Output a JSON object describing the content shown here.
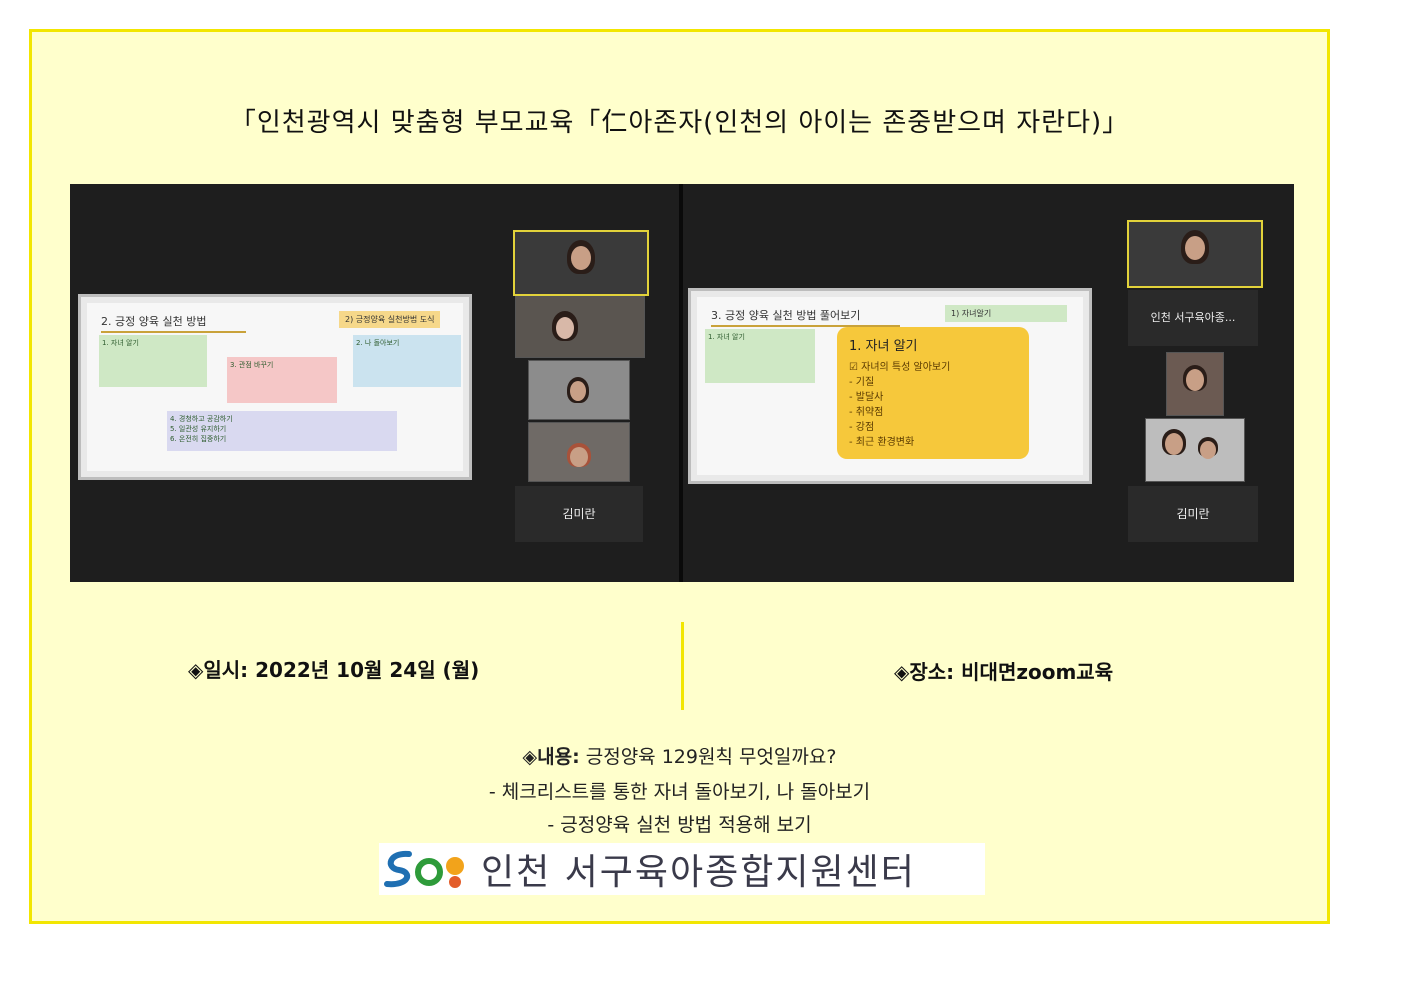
{
  "title": "「인천광역시 맞춤형 부모교육「仁아존자(인천의 아이는 존중받으며 자란다)」",
  "left_screen": {
    "slide_title": "2. 긍정 양육 실천 방법",
    "slide_tag": "2) 긍정양육 실천방법 도식",
    "boxes": [
      "1. 자녀 알기",
      "2. 나 돌아보기",
      "3. 관점 바꾸기",
      "4. 경청하고 공감하기\n5. 일관성 유지하기\n6. 온전히 집중하기"
    ],
    "participant_name": "김미란",
    "captions": [
      "",
      "",
      "",
      "",
      "김미란"
    ]
  },
  "right_screen": {
    "slide_title": "3. 긍정 양육 실천 방법 풀어보기",
    "slide_tag": "1) 자녀알기",
    "box": "1. 자녀 알기",
    "bubble": {
      "title": "1. 자녀 알기",
      "check": "자녀의 특성 알아보기",
      "items": [
        "- 기질",
        "- 발달사",
        "- 취약점",
        "- 강점",
        "- 최근 환경변화"
      ]
    },
    "center_label": "인천 서구육아종...",
    "center_caption": "인천 서구육아종합지원센터",
    "participant_name": "김미란",
    "captions": [
      "",
      "김미란"
    ]
  },
  "date_label": "◈일시: 2022년 10월 24일 (월)",
  "place_label": "◈장소: 비대면zoom교육",
  "content": {
    "label": "◈내용:",
    "text": " 긍정양육 129원칙 무엇일까요?",
    "line2": "-  체크리스트를 통한 자녀 돌아보기, 나 돌아보기",
    "line3": "-  긍정양육 실천 방법 적용해 보기"
  },
  "logo_text": "인천 서구육아종합지원센터",
  "colors": {
    "frame_bg": "#ffffcc",
    "frame_border": "#f2e600",
    "bubble": "#f6c83b"
  }
}
